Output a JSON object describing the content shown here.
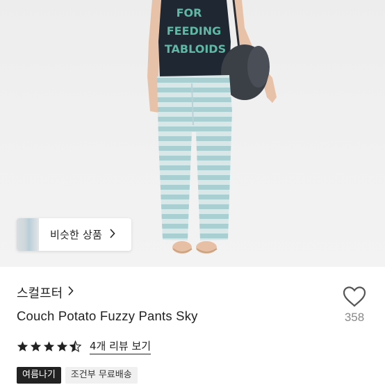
{
  "hero": {
    "shirt_text": [
      "FOR",
      "FEEDING",
      "TABLOIDS"
    ],
    "similar_button": {
      "label": "비슷한 상품",
      "icon": "chevron-right-icon"
    }
  },
  "product": {
    "brand": "스컬프터",
    "brand_icon": "chevron-right-icon",
    "title": "Couch Potato Fuzzy Pants Sky",
    "like_icon": "heart-outline-icon",
    "like_count": "358",
    "rating": 4.5,
    "review_link": "4개 리뷰 보기",
    "tags": [
      "여름나기",
      "조건부 무료배송"
    ]
  },
  "colors": {
    "pants_stripe_a": "#a9cfd2",
    "pants_stripe_b": "#d9e7e8",
    "shirt": "#1f2733",
    "shirt_text": "#5fb7a4",
    "bag": "#3b3f46"
  }
}
